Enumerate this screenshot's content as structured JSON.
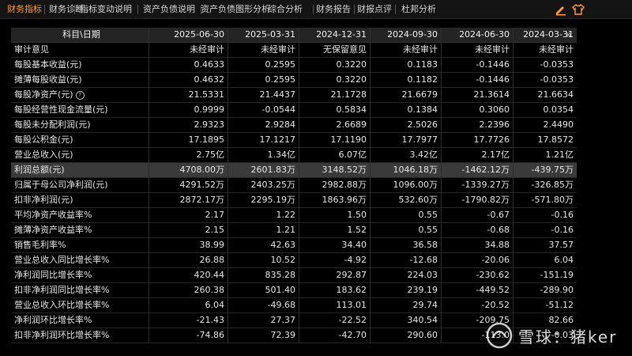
{
  "tabs": [
    "财务指标",
    "财务诊断",
    "指标变动说明",
    "资产负债说明",
    "资产负债图形分析",
    "综合分析",
    "财务报告",
    "财报点评",
    "杜邦分析"
  ],
  "active_tab": "财务指标",
  "toolbar_icons": [
    "edit-icon",
    "shirt-icon"
  ],
  "table": {
    "header_label": "科目\\日期",
    "columns": [
      "2025-06-30",
      "2025-03-31",
      "2024-12-31",
      "2024-09-30",
      "2024-06-30",
      "2024-03-31"
    ],
    "more_glyph": "»",
    "info_glyph": "?",
    "highlighted_row": "利润总额(元)",
    "rows": [
      {
        "label": "审计意见",
        "values": [
          "未经审计",
          "未经审计",
          "无保留意见",
          "未经审计",
          "未经审计",
          "未经审计"
        ]
      },
      {
        "label": "每股基本收益(元)",
        "values": [
          "0.4633",
          "0.2595",
          "0.3220",
          "0.1183",
          "-0.1446",
          "-0.0353"
        ]
      },
      {
        "label": "摊薄每股收益(元)",
        "values": [
          "0.4632",
          "0.2595",
          "0.3220",
          "0.1182",
          "-0.1446",
          "-0.0353"
        ]
      },
      {
        "label": "每股净资产(元)",
        "values": [
          "21.5331",
          "21.4437",
          "21.1728",
          "21.6679",
          "21.3614",
          "21.6634"
        ]
      },
      {
        "label": "每股经营性现金流量(元)",
        "values": [
          "0.9999",
          "-0.0544",
          "0.5834",
          "0.1384",
          "0.3060",
          "0.0354"
        ]
      },
      {
        "label": "每股未分配利润(元)",
        "values": [
          "2.9323",
          "2.9284",
          "2.6689",
          "2.5026",
          "2.2396",
          "2.4490"
        ]
      },
      {
        "label": "每股公积金(元)",
        "values": [
          "17.1895",
          "17.1217",
          "17.1190",
          "17.7977",
          "17.7726",
          "17.8572"
        ]
      },
      {
        "label": "营业总收入(元)",
        "values": [
          "2.75亿",
          "1.34亿",
          "6.07亿",
          "3.42亿",
          "2.17亿",
          "1.21亿"
        ]
      },
      {
        "label": "利润总额(元)",
        "values": [
          "4708.00万",
          "2601.83万",
          "3148.52万",
          "1046.18万",
          "-1462.12万",
          "-439.75万"
        ]
      },
      {
        "label": "归属于母公司净利润(元)",
        "values": [
          "4291.52万",
          "2403.25万",
          "2982.88万",
          "1096.00万",
          "-1339.27万",
          "-326.85万"
        ]
      },
      {
        "label": "扣非净利润(元)",
        "values": [
          "2872.17万",
          "2295.19万",
          "1863.96万",
          "532.60万",
          "-1790.82万",
          "-571.80万"
        ]
      },
      {
        "label": "平均净资产收益率%",
        "values": [
          "2.17",
          "1.22",
          "1.50",
          "0.55",
          "-0.67",
          "-0.16"
        ]
      },
      {
        "label": "摊薄净资产收益率%",
        "values": [
          "2.15",
          "1.21",
          "1.52",
          "0.55",
          "-0.68",
          "-0.16"
        ]
      },
      {
        "label": "销售毛利率%",
        "values": [
          "38.99",
          "42.63",
          "34.40",
          "36.58",
          "34.88",
          "37.57"
        ]
      },
      {
        "label": "营业总收入同比增长率%",
        "values": [
          "26.88",
          "10.52",
          "-4.92",
          "-12.68",
          "-20.06",
          "6.04"
        ]
      },
      {
        "label": "净利润同比增长率%",
        "values": [
          "420.44",
          "835.28",
          "292.87",
          "224.03",
          "-230.62",
          "-151.19"
        ]
      },
      {
        "label": "扣非净利润同比增长率%",
        "values": [
          "260.38",
          "501.40",
          "183.62",
          "239.19",
          "-449.52",
          "-289.90"
        ]
      },
      {
        "label": "营业总收入环比增长率%",
        "values": [
          "6.04",
          "-49.68",
          "113.01",
          "29.74",
          "-20.52",
          "-51.12"
        ]
      },
      {
        "label": "净利润环比增长率%",
        "values": [
          "-21.43",
          "27.37",
          "-22.52",
          "340.54",
          "-209.75",
          "82.66"
        ]
      },
      {
        "label": "扣非净利润环比增长率%",
        "values": [
          "-74.86",
          "72.39",
          "-42.70",
          "290.60",
          "-113.0",
          "-0.03"
        ]
      }
    ]
  },
  "watermark": {
    "text": "雪球：猪ker",
    "icon": "snowball-logo-icon"
  },
  "colors": {
    "active_tab": "#ff9d2c",
    "background": "#000000",
    "header_bg": "#242424",
    "highlight_row_bg": "#3a3a3a"
  }
}
